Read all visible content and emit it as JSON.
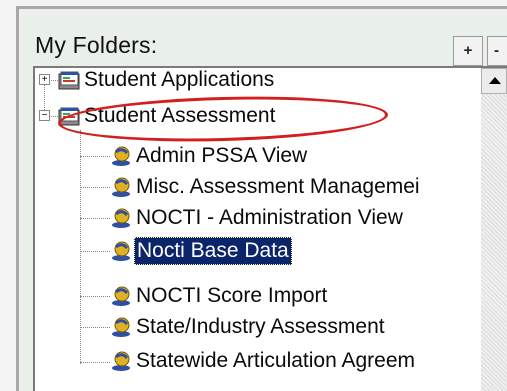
{
  "panel": {
    "title": "My Folders:",
    "add_button_label": "+",
    "collapse_button_label": "-"
  },
  "tree": {
    "folders": [
      {
        "label": "Student Applications",
        "expanded": false,
        "icon": "folder-window-icon"
      },
      {
        "label": "Student Assessment",
        "expanded": true,
        "icon": "folder-window-icon",
        "highlighted": true
      }
    ],
    "items": [
      {
        "label": "Admin PSSA View",
        "icon": "report-user-icon",
        "selected": false
      },
      {
        "label": "Misc. Assessment Managemei",
        "icon": "report-user-icon",
        "selected": false
      },
      {
        "label": "NOCTI - Administration View",
        "icon": "report-user-icon",
        "selected": false
      },
      {
        "label": "Nocti Base Data",
        "icon": "report-user-icon",
        "selected": true
      },
      {
        "label": "NOCTI Score Import",
        "icon": "report-user-icon",
        "selected": false
      },
      {
        "label": "State/Industry Assessment",
        "icon": "report-user-icon",
        "selected": false
      },
      {
        "label": "Statewide Articulation Agreem",
        "icon": "report-user-icon",
        "selected": false
      }
    ]
  },
  "colors": {
    "selection_bg": "#0b246a",
    "annotation": "#d21f1f"
  }
}
